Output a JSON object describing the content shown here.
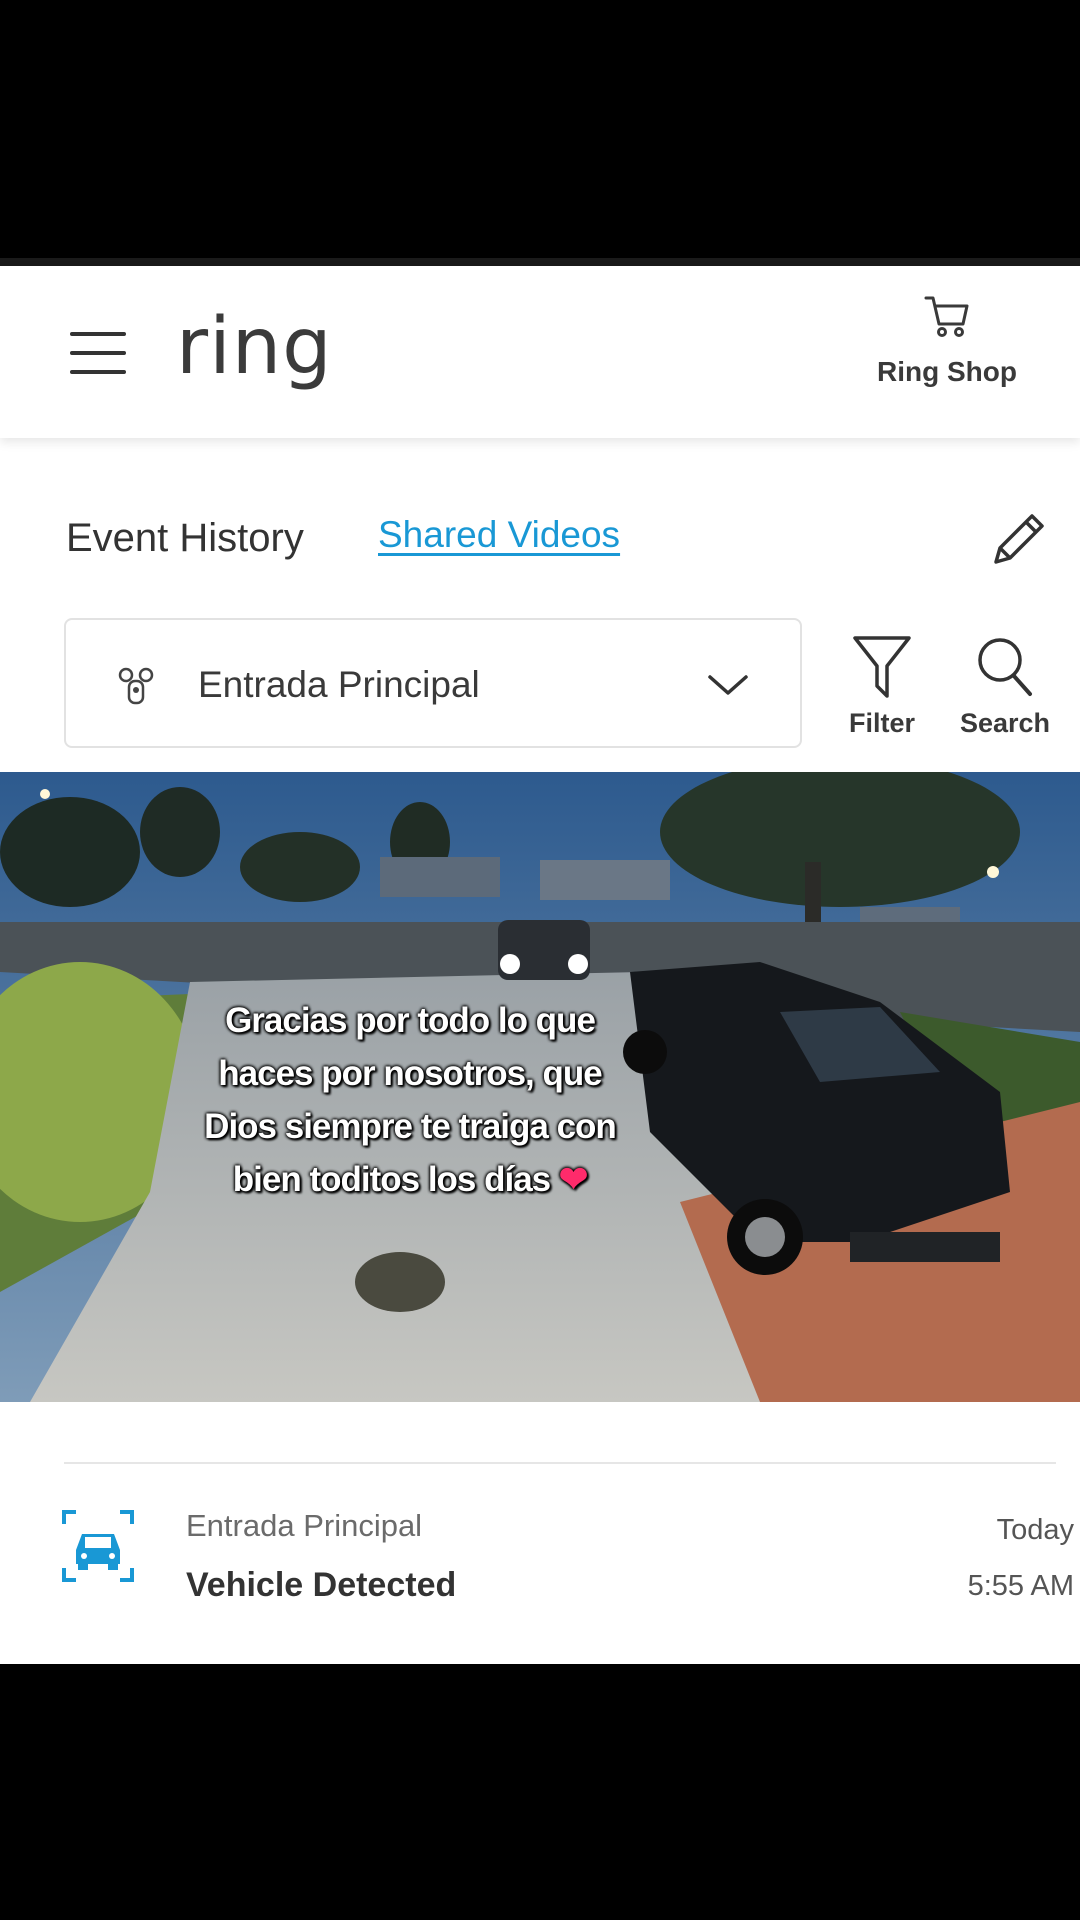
{
  "header": {
    "logo": "ring",
    "shop_label": "Ring Shop",
    "menu_icon": "hamburger-menu-icon",
    "shop_icon": "shopping-cart-icon"
  },
  "tabs": {
    "event_history": "Event History",
    "shared_videos": "Shared Videos",
    "edit_icon": "pencil-icon"
  },
  "device_selector": {
    "selected": "Entrada Principal",
    "icon": "doorbell-cameras-icon",
    "dropdown_icon": "chevron-down-icon"
  },
  "toolbar": {
    "filter_label": "Filter",
    "search_label": "Search"
  },
  "video": {
    "caption_lines": [
      "Gracias por todo lo que",
      "haces por nosotros, que",
      "Dios siempre te traiga con",
      "bien toditos los días"
    ],
    "caption_emoji": "❤"
  },
  "events": [
    {
      "device": "Entrada Principal",
      "type": "Vehicle Detected",
      "day": "Today",
      "time": "5:55 AM",
      "icon": "vehicle-detected-icon"
    }
  ],
  "colors": {
    "accent": "#1998d5",
    "text": "#333333",
    "heart": "#ff2b6b"
  }
}
